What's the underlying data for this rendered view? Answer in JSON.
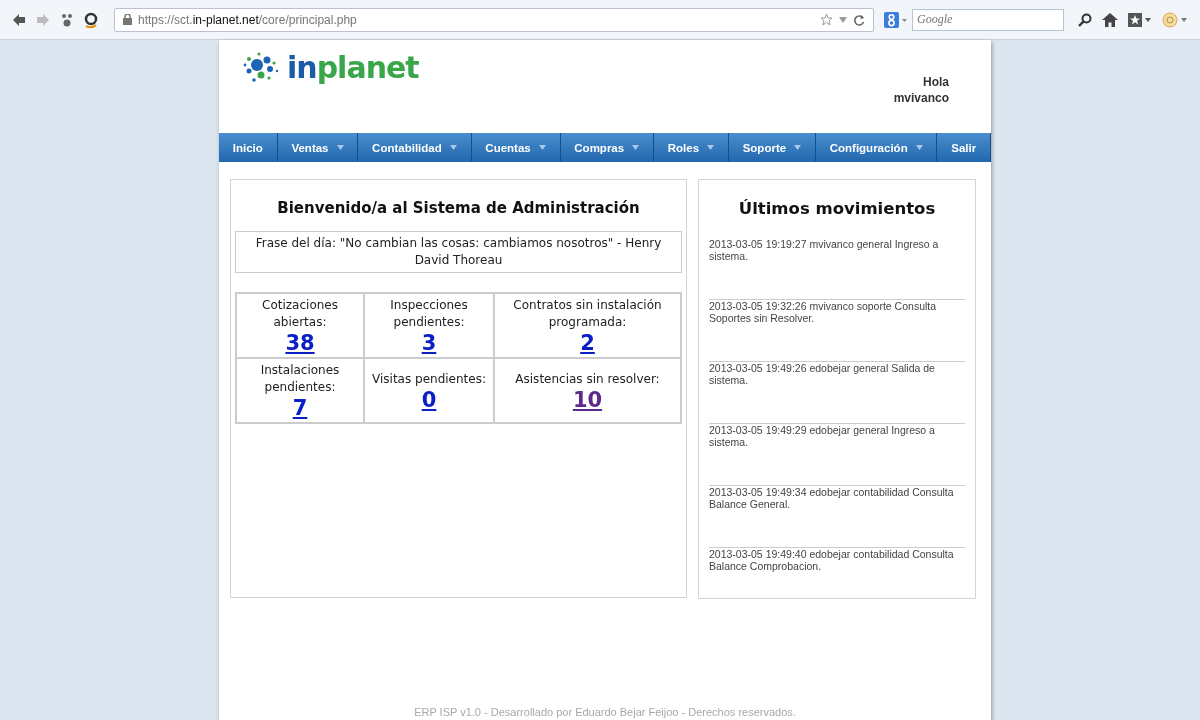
{
  "browser": {
    "url_host_prefix": "https://sct.",
    "url_host": "in-planet.net",
    "url_path": "/core/principal.php",
    "search_placeholder": "Google"
  },
  "header": {
    "logo_a": "in",
    "logo_b": "planet",
    "greeting": "Hola",
    "user": "mvivanco"
  },
  "nav": [
    {
      "label": "Inicio",
      "has_menu": false
    },
    {
      "label": "Ventas",
      "has_menu": true
    },
    {
      "label": "Contabilidad",
      "has_menu": true
    },
    {
      "label": "Cuentas",
      "has_menu": true
    },
    {
      "label": "Compras",
      "has_menu": true
    },
    {
      "label": "Roles",
      "has_menu": true
    },
    {
      "label": "Soporte",
      "has_menu": true
    },
    {
      "label": "Configuración",
      "has_menu": true
    },
    {
      "label": "Salir",
      "has_menu": false
    }
  ],
  "welcome": {
    "title": "Bienvenido/a al Sistema de Administración",
    "quote": "Frase del día:  \"No cambian las cosas: cambiamos nosotros\" - Henry David Thoreau"
  },
  "stats": [
    {
      "label": "Cotizaciones abiertas:",
      "value": "38",
      "visited": false
    },
    {
      "label": "Inspecciones pendientes:",
      "value": "3",
      "visited": false
    },
    {
      "label": "Contratos sin instalación programada:",
      "value": "2",
      "visited": false
    },
    {
      "label": "Instalaciones pendientes:",
      "value": "7",
      "visited": false
    },
    {
      "label": "Visitas pendientes:",
      "value": "0",
      "visited": false
    },
    {
      "label": "Asistencias sin resolver:",
      "value": "10",
      "visited": true
    }
  ],
  "movements": {
    "title": "Últimos movimientos",
    "items": [
      "2013-03-05 19:19:27 mvivanco general Ingreso a sistema.",
      "2013-03-05 19:32:26 mvivanco soporte Consulta Soportes sin Resolver.",
      "2013-03-05 19:49:26 edobejar general Salida de sistema.",
      "2013-03-05 19:49:29 edobejar general Ingreso a sistema.",
      "2013-03-05 19:49:34 edobejar contabilidad Consulta Balance General.",
      "2013-03-05 19:49:40 edobejar contabilidad Consulta Balance Comprobacion."
    ]
  },
  "footer": "ERP ISP v1.0 - Desarrollado por Eduardo Bejar Feijoo - Derechos reservados."
}
